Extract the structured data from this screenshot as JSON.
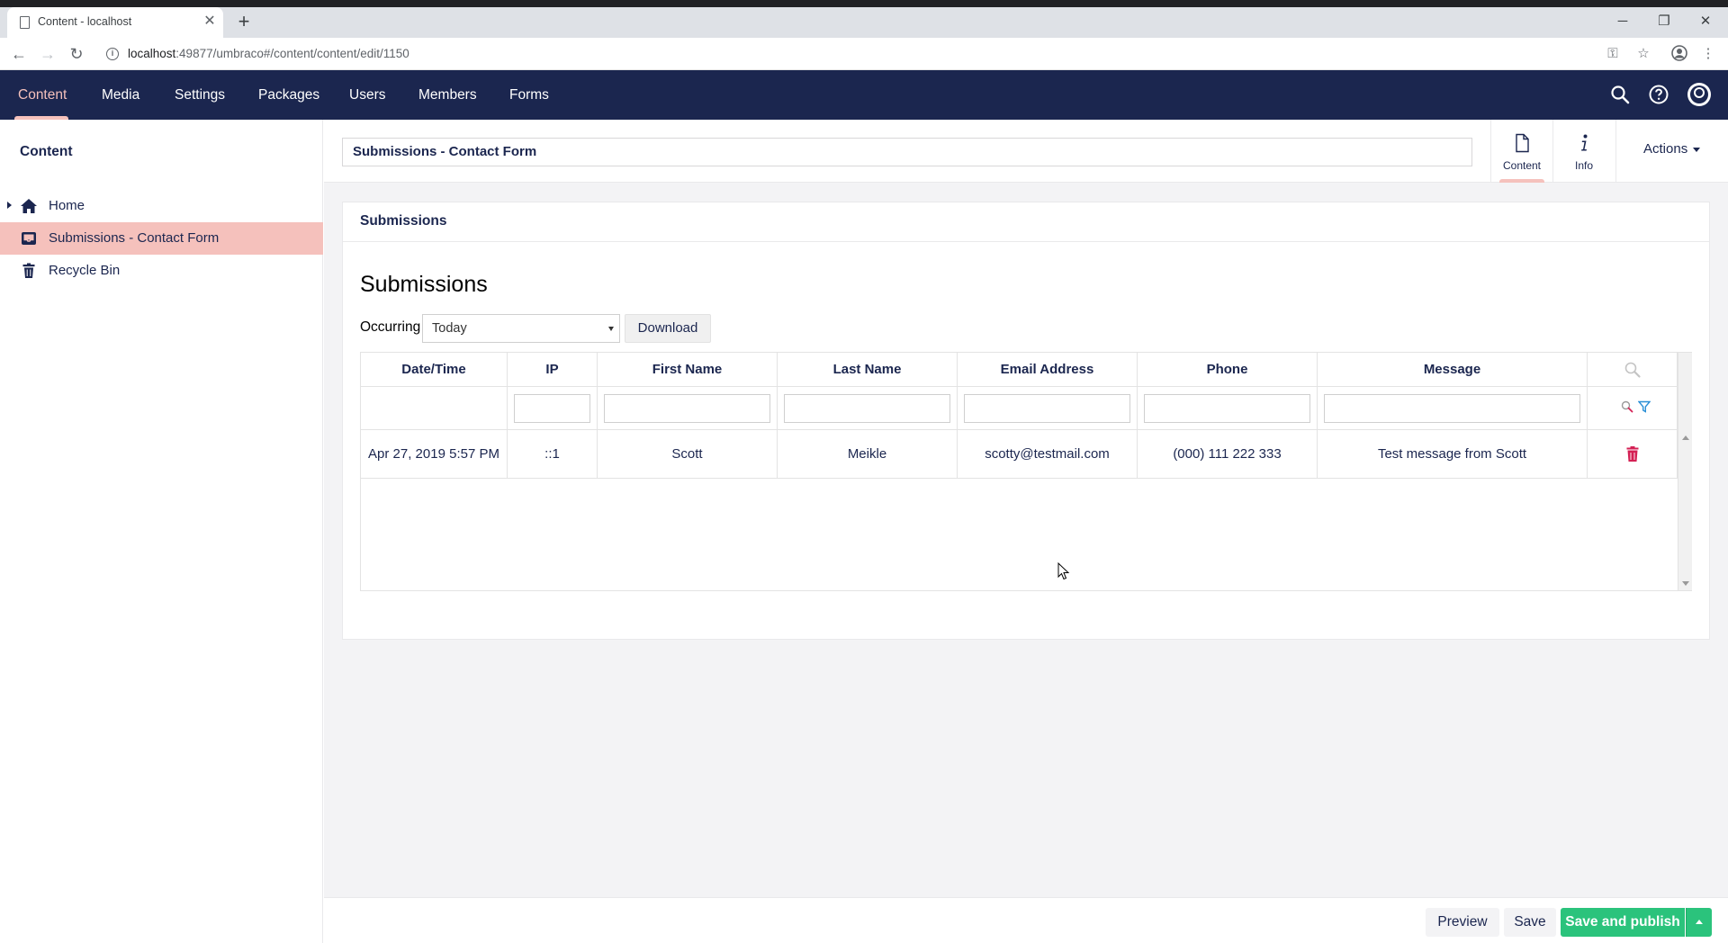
{
  "browser": {
    "tab_title": "Content - localhost",
    "url_host": "localhost",
    "url_path": ":49877/umbraco#/content/content/edit/1150"
  },
  "sections": [
    {
      "label": "Content"
    },
    {
      "label": "Media"
    },
    {
      "label": "Settings"
    },
    {
      "label": "Packages"
    },
    {
      "label": "Users"
    },
    {
      "label": "Members"
    },
    {
      "label": "Forms"
    }
  ],
  "tree": {
    "title": "Content",
    "items": [
      {
        "label": "Home",
        "icon": "home-icon"
      },
      {
        "label": "Submissions - Contact Form",
        "icon": "inbox-icon"
      },
      {
        "label": "Recycle Bin",
        "icon": "trash-icon"
      }
    ]
  },
  "editor": {
    "node_name": "Submissions - Contact Form",
    "apps": [
      {
        "label": "Content",
        "icon": "document-icon"
      },
      {
        "label": "Info",
        "icon": "info-icon"
      }
    ],
    "actions_label": "Actions"
  },
  "panel": {
    "title": "Submissions",
    "heading": "Submissions",
    "occurring_label": "Occurring",
    "occurring_value": "Today",
    "download_label": "Download"
  },
  "grid": {
    "columns": [
      "Date/Time",
      "IP",
      "First Name",
      "Last Name",
      "Email Address",
      "Phone",
      "Message"
    ],
    "rows": [
      {
        "datetime": "Apr 27, 2019 5:57 PM",
        "ip": "::1",
        "first_name": "Scott",
        "last_name": "Meikle",
        "email": "scotty@testmail.com",
        "phone": "(000) 111 222 333",
        "message": "Test message from Scott"
      }
    ]
  },
  "footer": {
    "preview_label": "Preview",
    "save_label": "Save",
    "publish_label": "Save and publish"
  },
  "colors": {
    "header_bg": "#1b264f",
    "accent_pink": "#f5c1bc",
    "publish_green": "#2bc37c",
    "delete_red": "#d42054"
  }
}
